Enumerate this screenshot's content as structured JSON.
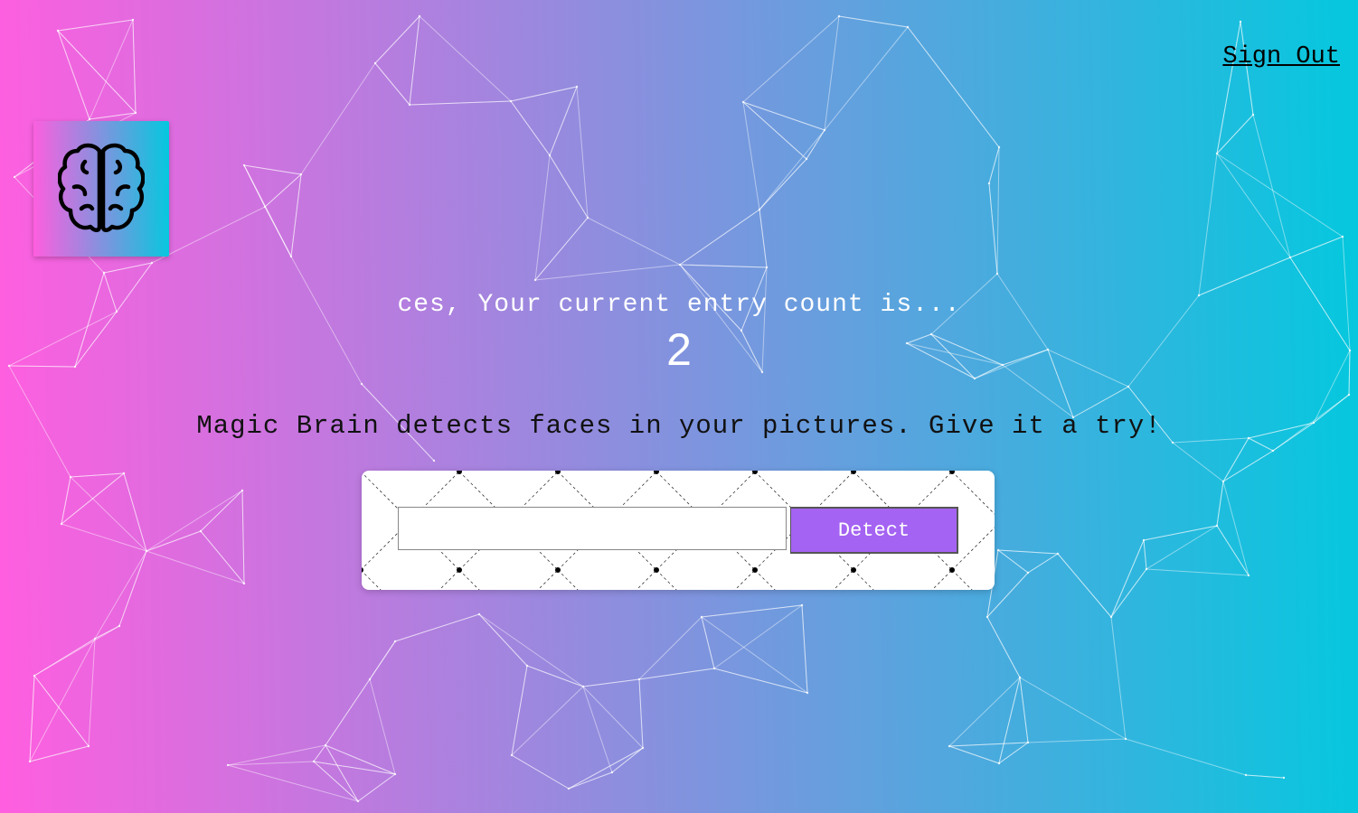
{
  "nav": {
    "signout_label": "Sign Out"
  },
  "logo": {
    "icon": "brain-icon"
  },
  "rank": {
    "message": "ces, Your current entry count is...",
    "count": "2"
  },
  "tagline": "Magic Brain detects faces in your pictures. Give it a try!",
  "form": {
    "input_value": "",
    "detect_label": "Detect"
  },
  "colors": {
    "gradient_start": "#ff5edf",
    "gradient_end": "#04c8de",
    "button": "#a463f2"
  }
}
